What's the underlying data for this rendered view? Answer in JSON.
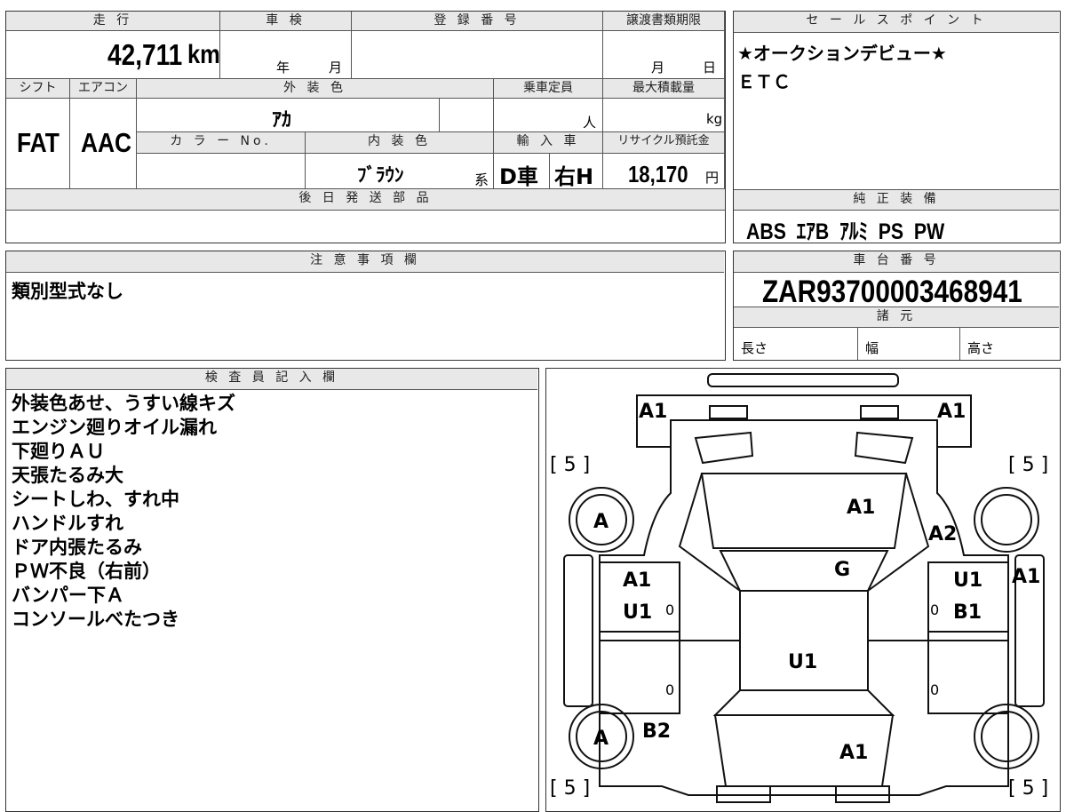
{
  "top_row": {
    "mileage_label": "走 行",
    "mileage_value": "42,711",
    "mileage_unit": "km",
    "shaken_label": "車 検",
    "shaken_year": "年",
    "shaken_month": "月",
    "reg_label": "登 録 番 号",
    "transfer_label": "譲渡書類期限",
    "transfer_month": "月",
    "transfer_day": "日"
  },
  "second_row": {
    "shift_label": "シフト",
    "shift_value": "FAT",
    "ac_label": "エアコン",
    "ac_value": "AAC",
    "exterior_label": "外 装 色",
    "exterior_value": "ｱｶ",
    "capacity_label": "乗車定員",
    "capacity_unit": "人",
    "load_label": "最大積載量",
    "load_unit": "kg",
    "color_no_label": "カ ラ ー No.",
    "interior_label": "内 装 色",
    "interior_value": "ﾌﾞﾗｳﾝ",
    "interior_suffix": "系",
    "import_label": "輸 入 車",
    "import_value": "D車",
    "handle_value": "右H",
    "recycle_label": "リサイクル預託金",
    "recycle_value": "18,170",
    "recycle_unit": "円"
  },
  "later_parts": {
    "label": "後 日 発 送 部 品",
    "value": ""
  },
  "sales_points": {
    "label": "セ ー ル ス ポ イ ン ト",
    "lines": [
      "★オークションデビュー★",
      "ＥＴＣ"
    ]
  },
  "standard_equipment": {
    "label": "純 正 装 備",
    "value": "ABS  ｴｱB  ｱﾙﾐ  PS  PW"
  },
  "notes": {
    "label": "注 意 事 項 欄",
    "value": "類別型式なし"
  },
  "chassis": {
    "label": "車 台 番 号",
    "value": "ZAR93700003468941"
  },
  "specs": {
    "label": "諸 元",
    "length": "長さ",
    "width": "幅",
    "height": "高さ"
  },
  "inspector": {
    "label": "検 査 員 記 入 欄",
    "lines": [
      "外装色あせ、うすい線キズ",
      "エンジン廻りオイル漏れ",
      "下廻りＡＵ",
      "天張たるみ大",
      "シートしわ、すれ中",
      "ハンドルすれ",
      "ドア内張たるみ",
      "ＰＷ不良（右前）",
      "バンパー下Ａ",
      "コンソールべたつき"
    ]
  },
  "diagram": {
    "bracket_5": "[ 5 ]",
    "tire": "A",
    "labels": {
      "front_left": "A1",
      "front_right": "A1",
      "hood": "A1",
      "fender_right": "A2",
      "windshield": "G",
      "door_fl_1": "A1",
      "door_fl_2": "U1",
      "door_fr_1": "U1",
      "door_fr_2": "B1",
      "side_right": "A1",
      "roof": "U1",
      "rear_left": "B2",
      "trunk": "A1",
      "zero": "0"
    }
  }
}
